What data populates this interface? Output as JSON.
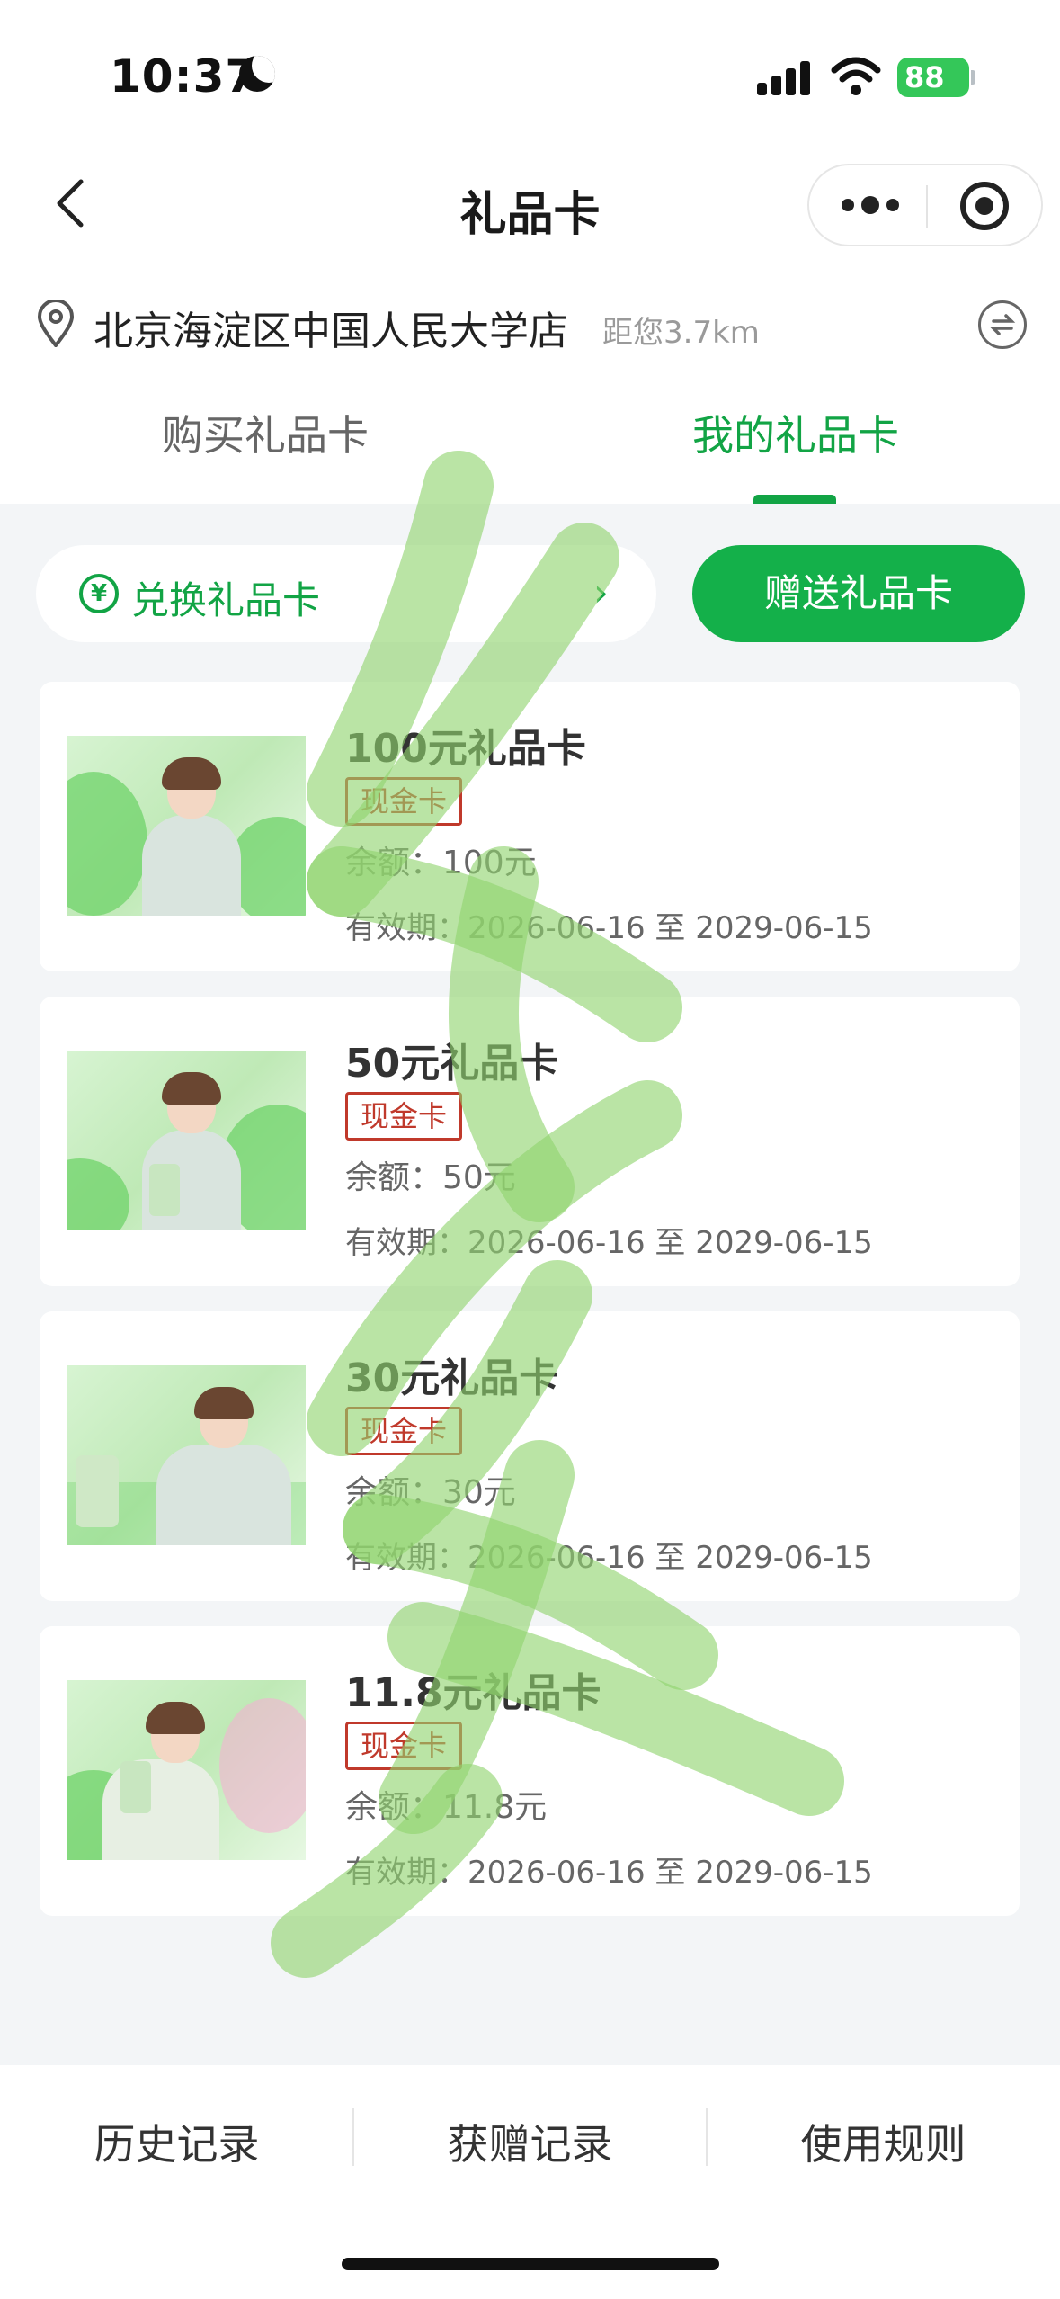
{
  "status_bar": {
    "time": "10:37",
    "battery": "88"
  },
  "nav": {
    "title": "礼品卡"
  },
  "store": {
    "name": "北京海淀区中国人民大学店",
    "distance": "距您3.7km"
  },
  "tabs": [
    {
      "label": "购买礼品卡",
      "active": false
    },
    {
      "label": "我的礼品卡",
      "active": true
    }
  ],
  "actions": {
    "redeem_label": "兑换礼品卡",
    "gift_label": "赠送礼品卡"
  },
  "cards": [
    {
      "title": "100元礼品卡",
      "badge": "现金卡",
      "balance": "余额：100元",
      "validity": "有效期：2026-06-16 至 2029-06-15"
    },
    {
      "title": "50元礼品卡",
      "badge": "现金卡",
      "balance": "余额：50元",
      "validity": "有效期：2026-06-16 至 2029-06-15"
    },
    {
      "title": "30元礼品卡",
      "badge": "现金卡",
      "balance": "余额：30元",
      "validity": "有效期：2026-06-16 至 2029-06-15"
    },
    {
      "title": "11.8元礼品卡",
      "badge": "现金卡",
      "balance": "余额：11.8元",
      "validity": "有效期：2026-06-16 至 2029-06-15"
    }
  ],
  "bottom_bar": [
    {
      "label": "历史记录"
    },
    {
      "label": "获赠记录"
    },
    {
      "label": "使用规则"
    }
  ],
  "colors": {
    "accent": "#14b04a",
    "badge": "#c0392b",
    "watermark": "#8fd36e"
  }
}
